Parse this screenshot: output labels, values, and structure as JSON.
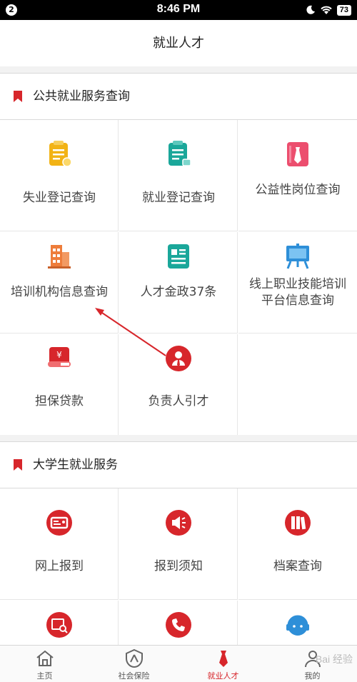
{
  "status_bar": {
    "notification_count": "2",
    "time": "8:46 PM",
    "battery": "73"
  },
  "header": {
    "title": "就业人才"
  },
  "sections": [
    {
      "title": "公共就业服务查询",
      "items": [
        {
          "label": "失业登记查询",
          "icon": "clipboard-yellow-icon"
        },
        {
          "label": "就业登记查询",
          "icon": "clipboard-teal-icon"
        },
        {
          "label": "公益性岗位查询",
          "icon": "tie-pink-icon"
        },
        {
          "label": "培训机构信息查询",
          "icon": "building-orange-icon"
        },
        {
          "label": "人才金政37条",
          "icon": "document-teal-icon"
        },
        {
          "label": "线上职业技能培训平台信息查询",
          "icon": "presentation-board-icon"
        },
        {
          "label": "担保贷款",
          "icon": "yuan-loan-icon"
        },
        {
          "label": "负责人引才",
          "icon": "person-red-icon"
        }
      ]
    },
    {
      "title": "大学生就业服务",
      "items": [
        {
          "label": "网上报到",
          "icon": "id-card-icon"
        },
        {
          "label": "报到须知",
          "icon": "megaphone-icon"
        },
        {
          "label": "档案查询",
          "icon": "archive-books-icon"
        },
        {
          "label": "",
          "icon": "search-document-icon"
        },
        {
          "label": "",
          "icon": "phone-icon"
        },
        {
          "label": "",
          "icon": "headset-icon"
        }
      ]
    }
  ],
  "tabs": [
    {
      "label": "主页",
      "icon": "home-icon",
      "active": false
    },
    {
      "label": "社会保险",
      "icon": "shield-person-icon",
      "active": false
    },
    {
      "label": "就业人才",
      "icon": "tie-icon",
      "active": true
    },
    {
      "label": "我的",
      "icon": "user-icon",
      "active": false
    }
  ],
  "watermark": "Bai 经验",
  "colors": {
    "accent_red": "#d7262b",
    "teal": "#1aa79a",
    "yellow": "#f2b315",
    "orange": "#ee7d3b",
    "pink": "#ec4e6e",
    "blue": "#2e8fd8"
  }
}
